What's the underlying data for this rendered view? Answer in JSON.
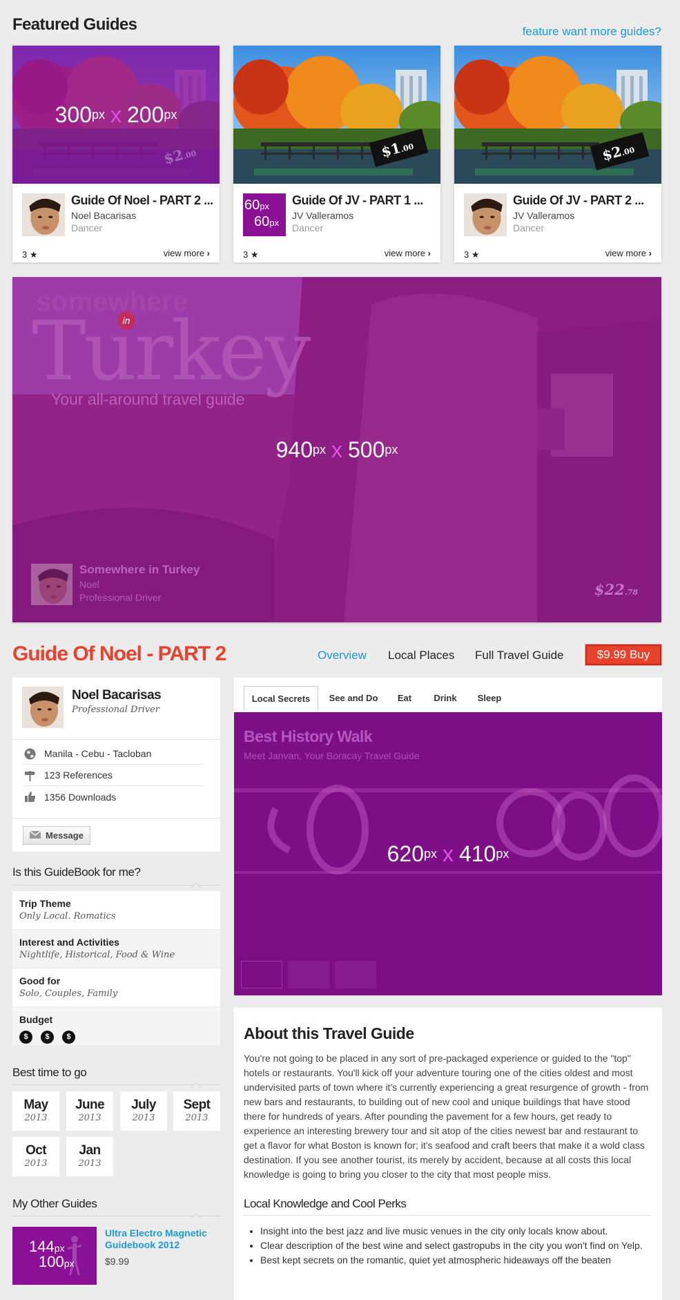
{
  "featured": {
    "title": "Featured Guides",
    "more_link": "feature want more guides?",
    "cards": [
      {
        "image_dim_w": "300",
        "image_dim_h": "200",
        "unit": "px",
        "x": "x",
        "price_main": "$2",
        "price_cents": ".00",
        "title": "Guide Of Noel - PART 2 ...",
        "author": "Noel Bacarisas",
        "role": "Dancer",
        "rating": "3",
        "view_more": "view more"
      },
      {
        "avatar_dim_w": "60",
        "avatar_dim_h": "60",
        "unit": "px",
        "price_main": "$1",
        "price_cents": ".00",
        "title": "Guide Of JV - PART 1 ...",
        "author": "JV Valleramos",
        "role": "Dancer",
        "rating": "3",
        "view_more": "view more"
      },
      {
        "price_main": "$2",
        "price_cents": ".00",
        "title": "Guide Of JV - PART 2 ...",
        "author": "JV Valleramos",
        "role": "Dancer",
        "rating": "3",
        "view_more": "view more"
      }
    ]
  },
  "hero": {
    "line1": "somewhere",
    "in": "in",
    "line2": "Turkey",
    "tagline": "Your all-around travel guide",
    "dim_w": "940",
    "dim_h": "500",
    "unit": "px",
    "x": "x",
    "guide_name": "Somewhere in Turkey",
    "author": "Noel",
    "role": "Professional Driver",
    "price_main": "$22",
    "price_cents": ".78"
  },
  "guide": {
    "title": "Guide Of Noel - PART 2",
    "nav": [
      "Overview",
      "Local Places",
      "Full Travel Guide"
    ],
    "buy": "$9.99 Buy"
  },
  "profile": {
    "name": "Noel Bacarisas",
    "role": "Professional Driver",
    "location": "Manila - Cebu - Tacloban",
    "references": "123 References",
    "downloads": "1356 Downloads",
    "message": "Message"
  },
  "for_me": {
    "title": "Is this GuideBook for me?",
    "items": [
      {
        "label": "Trip Theme",
        "value": "Only Local. Romatics"
      },
      {
        "label": "Interest and Activities",
        "value": "Nightlife, Historical, Food & Wine"
      },
      {
        "label": "Good for",
        "value": "Solo, Couples, Family"
      },
      {
        "label": "Budget",
        "value": ""
      }
    ],
    "budget_symbol": "$",
    "budget_level": 3
  },
  "best_time": {
    "title": "Best time to go",
    "months": [
      {
        "m": "May",
        "y": "2013"
      },
      {
        "m": "June",
        "y": "2013"
      },
      {
        "m": "July",
        "y": "2013"
      },
      {
        "m": "Sept",
        "y": "2013"
      },
      {
        "m": "Oct",
        "y": "2013"
      },
      {
        "m": "Jan",
        "y": "2013"
      }
    ]
  },
  "other_guides": {
    "title": "My Other Guides",
    "dim_w": "144",
    "dim_h": "100",
    "unit": "px",
    "name": "Ultra Electro Magnetic Guidebook 2012",
    "price": "$9.99"
  },
  "tabs": {
    "items": [
      "Local Secrets",
      "See and Do",
      "Eat",
      "Drink",
      "Sleep"
    ],
    "slide_title": "Best History Walk",
    "slide_sub": "Meet Janvan, Your Boracay Travel Guide",
    "dim_w": "620",
    "dim_h": "410",
    "unit": "px",
    "x": "x"
  },
  "about": {
    "title": "About this Travel Guide",
    "body": "You're not going to be placed in any sort of pre-packaged experience or guided to the \"top\" hotels or restaurants. You'll kick off your adventure touring one of the cities oldest and most undervisited parts of town where it's currently experiencing a great resurgence of growth - from new bars and restaurants, to building out of new cool and unique buildings that have stood there for hundreds of years. After pounding the pavement for a few hours, get ready to experience an interesting brewery tour and sit atop of the cities newest bar and restaurant to get a flavor for what Boston is known for; it's seafood and craft beers that make it a wold class destination. If you see another tourist, its merely by accident, because at all costs this local knowledge is going to bring you closer to the city that most people miss.",
    "perks_title": "Local Knowledge and Cool Perks",
    "perks": [
      "Insight into the best jazz and live music venues in the city only locals know about.",
      "Clear description of the best wine and select gastropubs in the city you won't find on Yelp.",
      "Best kept secrets on the romantic, quiet yet atmospheric hideaways off the beaten"
    ]
  },
  "colors": {
    "accent_red": "#e8412c",
    "link_blue": "#1a9ad6",
    "placeholder_purple": "#8a1196",
    "dim_x_pink": "#e04fe8"
  }
}
